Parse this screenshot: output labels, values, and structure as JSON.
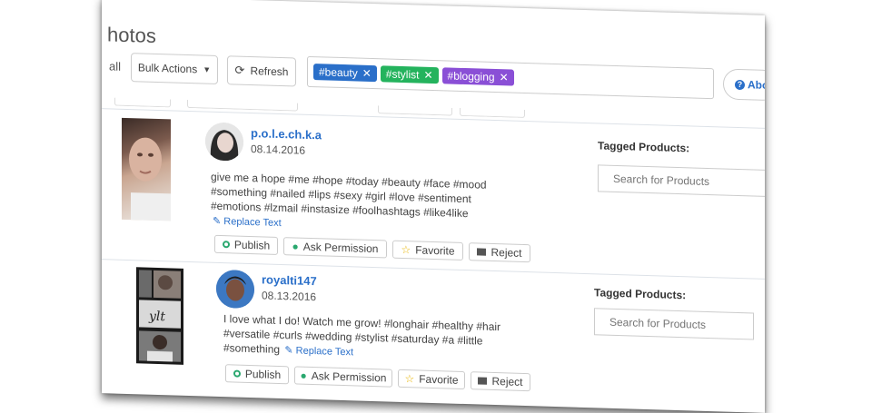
{
  "header": {
    "title": "hotos",
    "filter_all": "all",
    "bulk_label": "Bulk Actions",
    "refresh_label": "Refresh",
    "about_label": "Abo",
    "tags": [
      {
        "label": "#beauty",
        "color": "#2a6fc9"
      },
      {
        "label": "#stylist",
        "color": "#24b35d"
      },
      {
        "label": "#blogging",
        "color": "#8a4fd6"
      }
    ]
  },
  "posts": [
    {
      "username": "p.o.l.e.ch.k.a",
      "date": "08.14.2016",
      "caption": "give me a hope #me #hope #today #beauty #face #mood #something #nailed #lips #sexy #girl #love #sentiment #emotions #lzmail #instasize #foolhashtags #like4like",
      "replace_text": "Replace Text",
      "actions": {
        "publish": "Publish",
        "ask": "Ask Permission",
        "favorite": "Favorite",
        "reject": "Reject"
      },
      "tagged_label": "Tagged Products:",
      "search_placeholder": "Search for Products"
    },
    {
      "username": "royalti147",
      "date": "08.13.2016",
      "caption": "I love what I do! Watch me grow! #longhair #healthy #hair #versatile #curls #wedding #stylist #saturday #a #little #something",
      "replace_text": "Replace Text",
      "actions": {
        "publish": "Publish",
        "ask": "Ask Permission",
        "favorite": "Favorite",
        "reject": "Reject"
      },
      "tagged_label": "Tagged Products:",
      "search_placeholder": "Search for Products"
    }
  ]
}
